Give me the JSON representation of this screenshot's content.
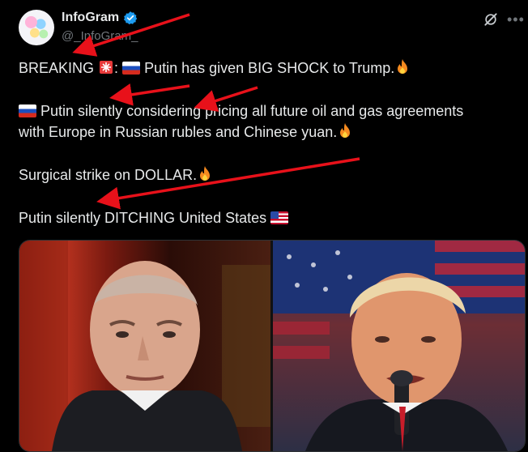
{
  "author": {
    "display_name": "InfoGram",
    "handle": "@_InfoGram_"
  },
  "header_icons": [
    "grok-icon",
    "more-icon"
  ],
  "post": {
    "line1_a": "BREAKING",
    "line1_colon": ":",
    "line1_b": "Putin has given BIG SHOCK to Trump.",
    "line2_a": "Putin silently considering pricing all future oil and gas agreements",
    "line2_b": "with Europe in Russian rubles and Chinese yuan.",
    "line3": "Surgical strike on DOLLAR.",
    "line4": "Putin silently DITCHING United States"
  },
  "media": {
    "left_photo": "putin-photo",
    "right_photo": "trump-photo"
  },
  "colors": {
    "background": "#000000",
    "text": "#e7e9ea",
    "secondary_text": "#71767b",
    "verified_blue": "#1d9bf0",
    "annotation_red": "#e8111a"
  }
}
